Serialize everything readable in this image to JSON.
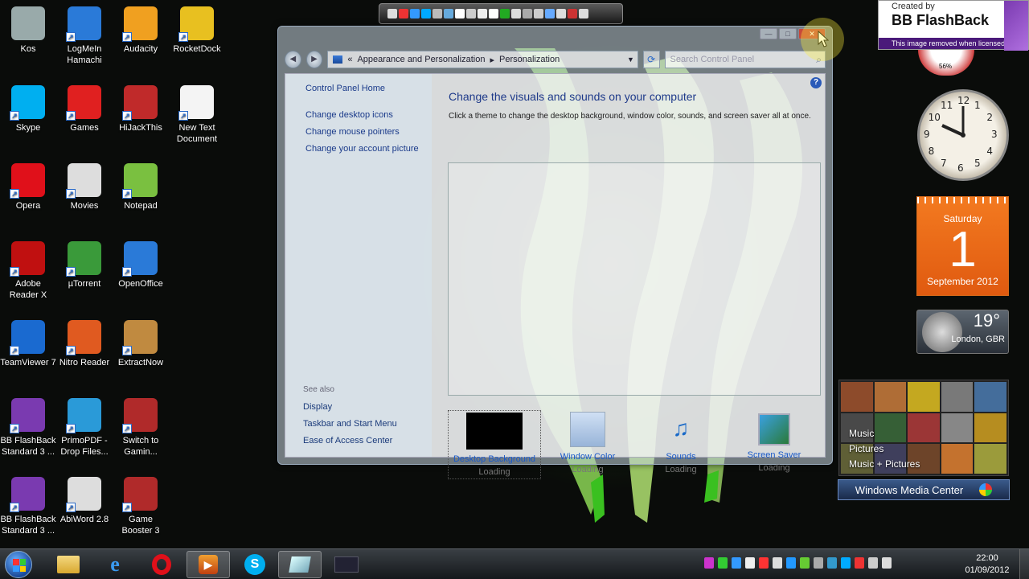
{
  "desktop": {
    "icons": [
      {
        "label": "Kos",
        "icon": "recycle-bin-icon"
      },
      {
        "label": "LogMeIn Hamachi",
        "icon": "hamachi-icon"
      },
      {
        "label": "Audacity",
        "icon": "audacity-icon"
      },
      {
        "label": "RocketDock",
        "icon": "rocketdock-icon"
      },
      {
        "label": "Skype",
        "icon": "skype-icon"
      },
      {
        "label": "Games",
        "icon": "games-icon"
      },
      {
        "label": "HiJackThis",
        "icon": "hijackthis-icon"
      },
      {
        "label": "New Text Document",
        "icon": "text-document-icon"
      },
      {
        "label": "Opera",
        "icon": "opera-icon"
      },
      {
        "label": "Movies",
        "icon": "dvd-icon"
      },
      {
        "label": "Notepad",
        "icon": "notepad-icon"
      },
      {
        "label": "Adobe Reader X",
        "icon": "adobe-reader-icon"
      },
      {
        "label": "µTorrent",
        "icon": "utorrent-icon"
      },
      {
        "label": "OpenOffice",
        "icon": "openoffice-icon"
      },
      {
        "label": "TeamViewer 7",
        "icon": "teamviewer-icon"
      },
      {
        "label": "Nitro Reader",
        "icon": "nitro-reader-icon"
      },
      {
        "label": "ExtractNow",
        "icon": "extractnow-icon"
      },
      {
        "label": "BB FlashBack Standard 3 ...",
        "icon": "flashback-icon"
      },
      {
        "label": "PrimoPDF - Drop Files...",
        "icon": "primopdf-icon"
      },
      {
        "label": "Switch to Gamin...",
        "icon": "game-booster-icon"
      },
      {
        "label": "BB FlashBack Standard 3 ...",
        "icon": "flashback-icon"
      },
      {
        "label": "AbiWord 2.8",
        "icon": "abiword-icon"
      },
      {
        "label": "Game Booster 3",
        "icon": "game-booster-icon"
      }
    ]
  },
  "watermark": {
    "created": "Created by",
    "brand": "BB FlashBack",
    "note": "This image removed when licensed"
  },
  "gadgets": {
    "calendar": {
      "day": "Saturday",
      "date": "1",
      "month": "September 2012"
    },
    "weather": {
      "temp": "19°",
      "location": "London, GBR"
    },
    "clock_numbers": [
      "12",
      "1",
      "2",
      "3",
      "4",
      "5",
      "6",
      "7",
      "8",
      "9",
      "10",
      "11"
    ],
    "mini_clock_text": "56%",
    "media_center": {
      "items": [
        "Music",
        "Pictures",
        "Music + Pictures"
      ],
      "title": "Windows Media Center"
    }
  },
  "window": {
    "breadcrumb": {
      "prefix": "«",
      "part1": "Appearance and Personalization",
      "sep": "▸",
      "part2": "Personalization"
    },
    "search_placeholder": "Search Control Panel",
    "sidebar": {
      "home": "Control Panel Home",
      "links": [
        "Change desktop icons",
        "Change mouse pointers",
        "Change your account picture"
      ],
      "see_also": "See also",
      "see_also_links": [
        "Display",
        "Taskbar and Start Menu",
        "Ease of Access Center"
      ]
    },
    "heading": "Change the visuals and sounds on your computer",
    "description": "Click a theme to change the desktop background, window color, sounds, and screen saver all at once.",
    "settings": [
      {
        "label": "Desktop Background",
        "status": "Loading"
      },
      {
        "label": "Window Color",
        "status": "Loading"
      },
      {
        "label": "Sounds",
        "status": "Loading"
      },
      {
        "label": "Screen Saver",
        "status": "Loading"
      }
    ]
  },
  "taskbar": {
    "time": "22:00",
    "date": "01/09/2012"
  },
  "colors": {
    "accent_blue": "#1a5ac8",
    "wallpaper_green": "#6fdc3a",
    "calendar_orange": "#f37a20"
  }
}
